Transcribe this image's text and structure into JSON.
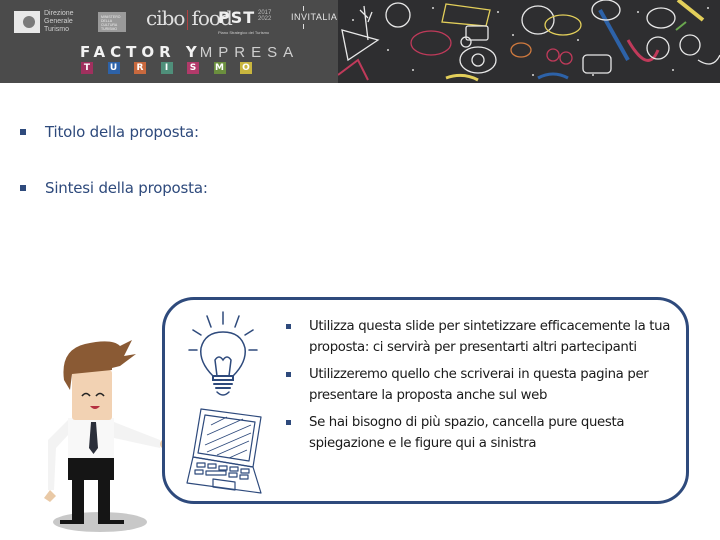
{
  "header": {
    "logos": {
      "dgt_lines": [
        "Direzione",
        "Generale",
        "Turismo"
      ],
      "ministry_lines": [
        "MINISTERO",
        "DELLA CULTURA",
        "TURISMO"
      ],
      "cibo_food": "cibo | food",
      "pst_title": "PST",
      "pst_years": [
        "2017",
        "2022"
      ],
      "pst_subtitle": "Piano Strategico del Turismo",
      "invitalia": "INVITALIA"
    },
    "brand": {
      "part1": "FACTOR Y",
      "part2": "MPRESA"
    },
    "tiles": [
      {
        "letter": "T",
        "color": "#a0305e"
      },
      {
        "letter": "U",
        "color": "#2d62a8"
      },
      {
        "letter": "R",
        "color": "#c8693e"
      },
      {
        "letter": "I",
        "color": "#4f8f7a"
      },
      {
        "letter": "S",
        "color": "#b23a6a"
      },
      {
        "letter": "M",
        "color": "#6b8f3e"
      },
      {
        "letter": "O",
        "color": "#c9b63e"
      }
    ]
  },
  "main": {
    "fields": [
      {
        "label": "Titolo della proposta:"
      },
      {
        "label": "Sintesi della proposta:"
      }
    ]
  },
  "info_box": {
    "bullets": [
      "Utilizza questa slide per sintetizzare efficacemente la tua proposta: ci servirà per presentarti altri partecipanti",
      "Utilizzeremo quello che scriverai in questa pagina per presentare la proposta anche sul web",
      "Se hai bisogno di più spazio, cancella pure questa spiegazione e le figure qui a sinistra"
    ]
  },
  "colors": {
    "accent": "#2e4a7c",
    "header_bg": "#4b4b4b",
    "chalkboard": "#2e2e30",
    "body_text": "#1a1a1a"
  }
}
